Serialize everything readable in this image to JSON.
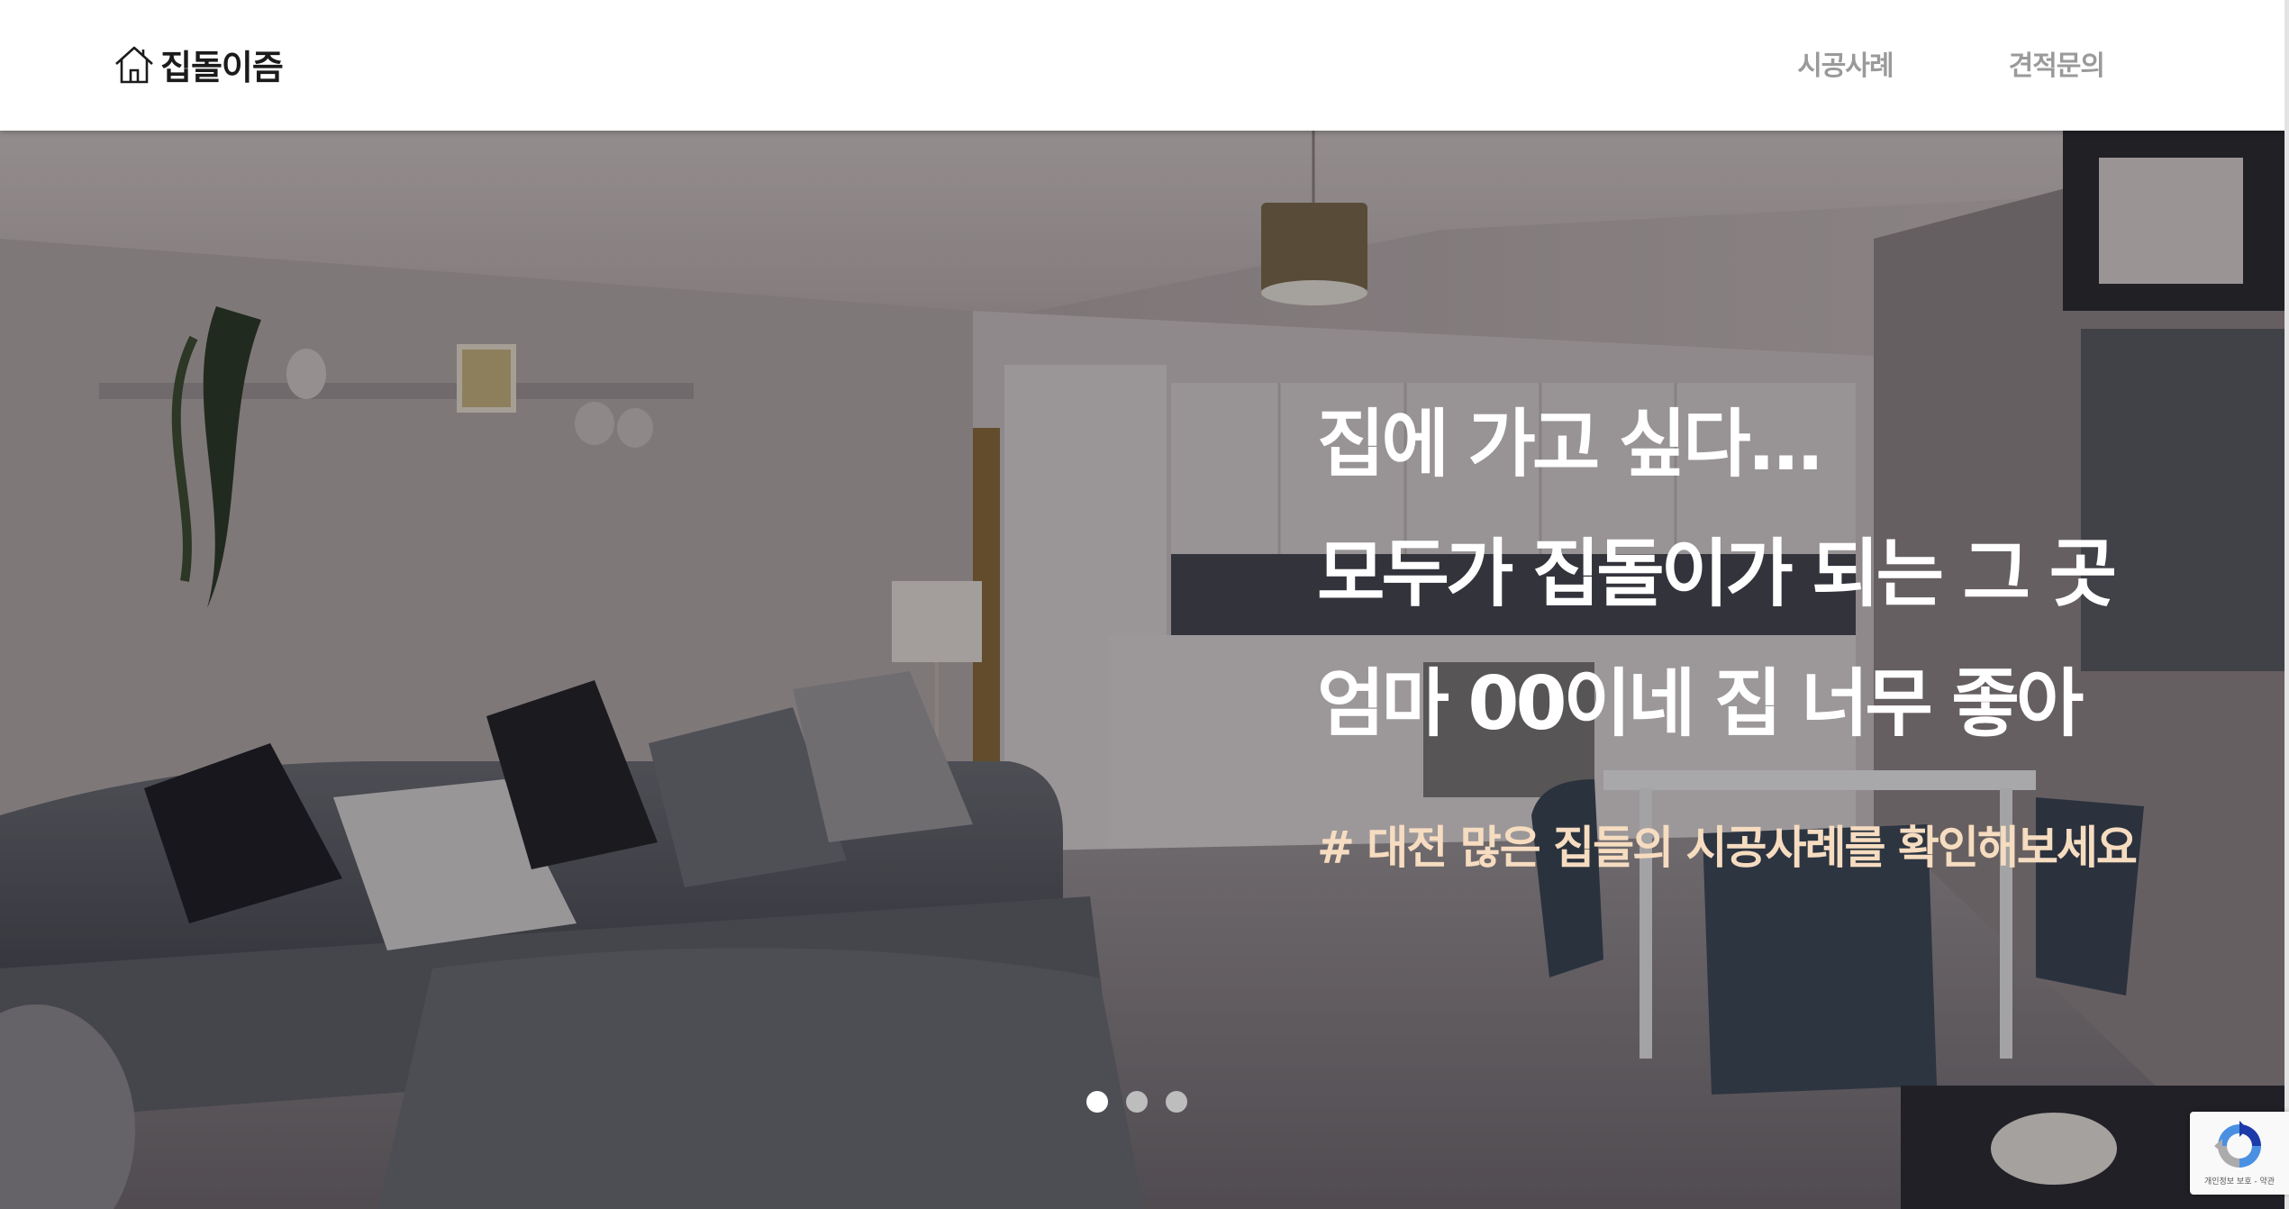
{
  "header": {
    "logo_text": "집돌이즘",
    "nav": [
      {
        "label": "시공사례"
      },
      {
        "label": "견적문의"
      }
    ]
  },
  "hero": {
    "lines": [
      "집에 가고 싶다...",
      "모두가 집돌이가 되는 그 곳",
      "엄마 00이네 집 너무 좋아"
    ],
    "tagline": "# 대전 많은 집들의 시공사례를 확인해보세요",
    "slides": {
      "count": 3,
      "active": 1
    }
  },
  "recaptcha": {
    "text": "개인정보 보호 - 약관"
  },
  "colors": {
    "nav_text": "#9a9a9a",
    "hero_text": "#ffffff",
    "tagline": "#f6dcc0",
    "dot_active": "#ffffff",
    "dot_inactive": "#bdbdbd"
  }
}
